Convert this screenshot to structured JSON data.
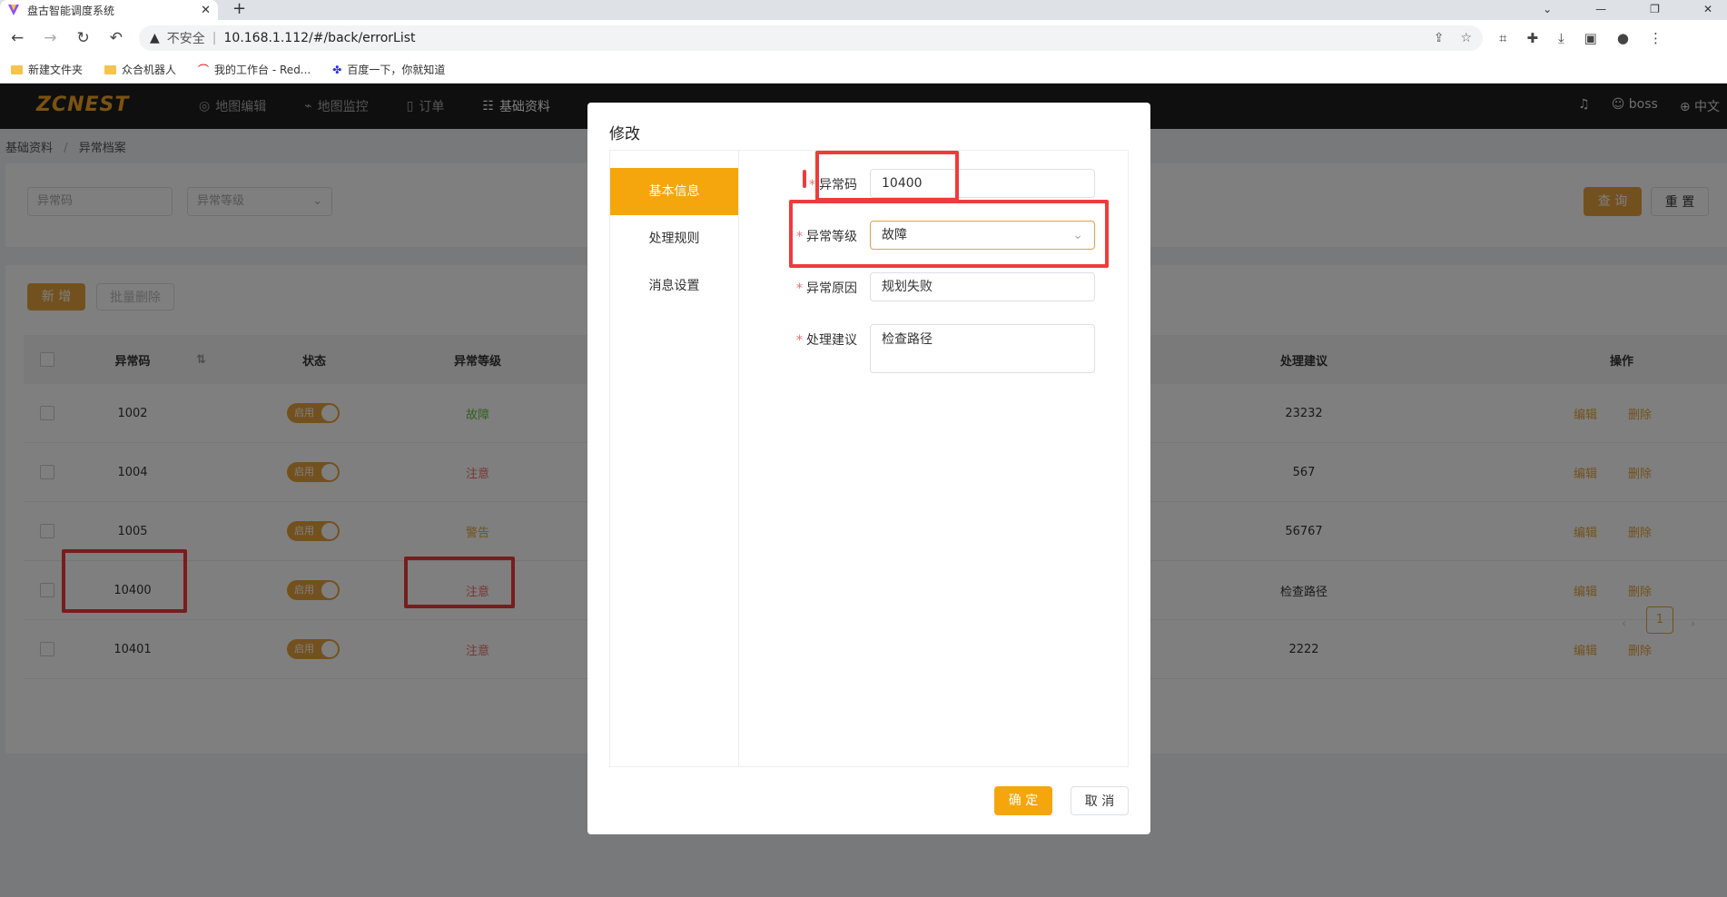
{
  "browser": {
    "tab_title": "盘古智能调度系统",
    "tab_close": "✕",
    "new_tab": "+",
    "insecure": "不安全",
    "url": "10.168.1.112/#/back/errorList",
    "bookmarks": [
      "新建文件夹",
      "众合机器人",
      "我的工作台 - Red...",
      "百度一下，你就知道"
    ],
    "user": "boss",
    "lang": "中文"
  },
  "nav": {
    "logo": "ZCNEST",
    "items": [
      "地图编辑",
      "地图监控",
      "订单",
      "基础资料"
    ]
  },
  "breadcrumb": [
    "基础资料",
    "异常档案"
  ],
  "search": {
    "code_placeholder": "异常码",
    "level_placeholder": "异常等级",
    "query": "查 询",
    "reset": "重 置"
  },
  "actions": {
    "add": "新 增",
    "batch_delete": "批量删除"
  },
  "table": {
    "headers": {
      "code": "异常码",
      "status": "状态",
      "level": "异常等级",
      "advice": "处理建议",
      "ops": "操作"
    },
    "rows": [
      {
        "code": "1002",
        "status": "启用",
        "level": "故障",
        "level_type": "fault",
        "advice": "23232"
      },
      {
        "code": "1004",
        "status": "启用",
        "level": "注意",
        "level_type": "note",
        "advice": "567"
      },
      {
        "code": "1005",
        "status": "启用",
        "level": "警告",
        "level_type": "warn",
        "advice": "56767"
      },
      {
        "code": "10400",
        "status": "启用",
        "level": "注意",
        "level_type": "note",
        "advice": "检查路径"
      },
      {
        "code": "10401",
        "status": "启用",
        "level": "注意",
        "level_type": "note",
        "advice": "2222"
      }
    ],
    "edit": "编辑",
    "delete": "删除",
    "page": "1"
  },
  "modal": {
    "title": "修改",
    "tabs": [
      "基本信息",
      "处理规则",
      "消息设置"
    ],
    "labels": {
      "code": "异常码",
      "level": "异常等级",
      "reason": "异常原因",
      "advice": "处理建议"
    },
    "values": {
      "code": "10400",
      "level": "故障",
      "reason": "规划失败",
      "advice": "检查路径"
    },
    "confirm": "确 定",
    "cancel": "取 消"
  },
  "colors": {
    "accent": "#f5a60d",
    "annotation": "#ee3b3b"
  }
}
